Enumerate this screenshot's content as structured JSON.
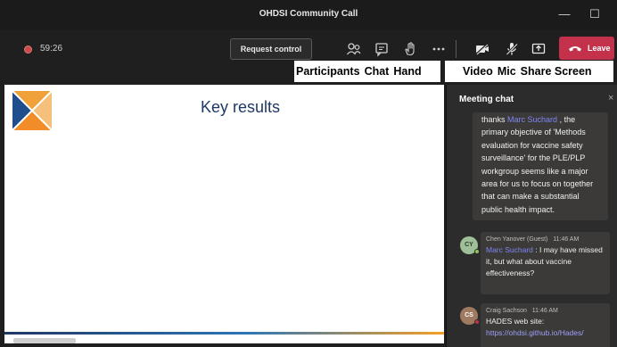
{
  "window": {
    "title": "OHDSI Community Call",
    "minimize": "—",
    "maximize": "☐"
  },
  "toolbar": {
    "timer": "59:26",
    "request_control": "Request control",
    "leave": "Leave"
  },
  "icon_labels": {
    "group1": [
      "Participants",
      "Chat",
      "Hand"
    ],
    "group2": [
      "Video",
      "Mic",
      "Share Screen"
    ]
  },
  "slide": {
    "title": "Key results"
  },
  "chat": {
    "header": "Meeting chat",
    "close": "×",
    "messages": [
      {
        "lines_pre": "thanks ",
        "mention": "Marc Suchard",
        "lines_post": " , the primary objective of 'Methods evaluation for vaccine safety surveillance' for the PLE/PLP workgroup seems like a major area for us to focus on together that can make a substantial public health impact."
      },
      {
        "author": "Chen Yanover (Guest)",
        "time": "11:46 AM",
        "initials": "CY",
        "mention": "Marc Suchard",
        "text": " : I may have missed it, but what about vaccine effectiveness?"
      },
      {
        "author": "Craig Sachson",
        "time": "11:46 AM",
        "initials": "CS",
        "text": "HADES web site:",
        "link": "https://ohdsi.github.io/Hades/"
      }
    ]
  }
}
